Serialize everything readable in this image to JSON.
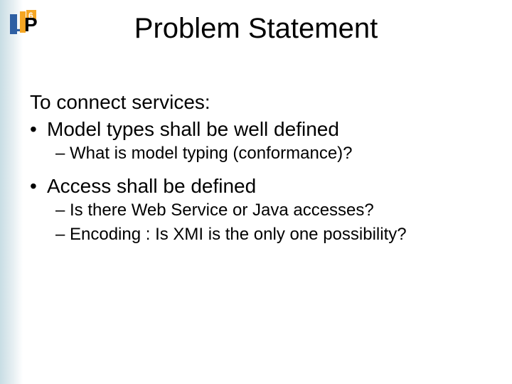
{
  "logo": {
    "text_l": "L",
    "text_p": "P",
    "badge": "6"
  },
  "title": "Problem Statement",
  "intro": "To connect services:",
  "bullets": [
    {
      "text": "Model types shall be well defined",
      "sub": [
        "What is model typing (conformance)?"
      ]
    },
    {
      "text": "Access shall be defined",
      "sub": [
        "Is there Web Service or Java accesses?",
        "Encoding : Is XMI is the only one possibility?"
      ]
    }
  ]
}
